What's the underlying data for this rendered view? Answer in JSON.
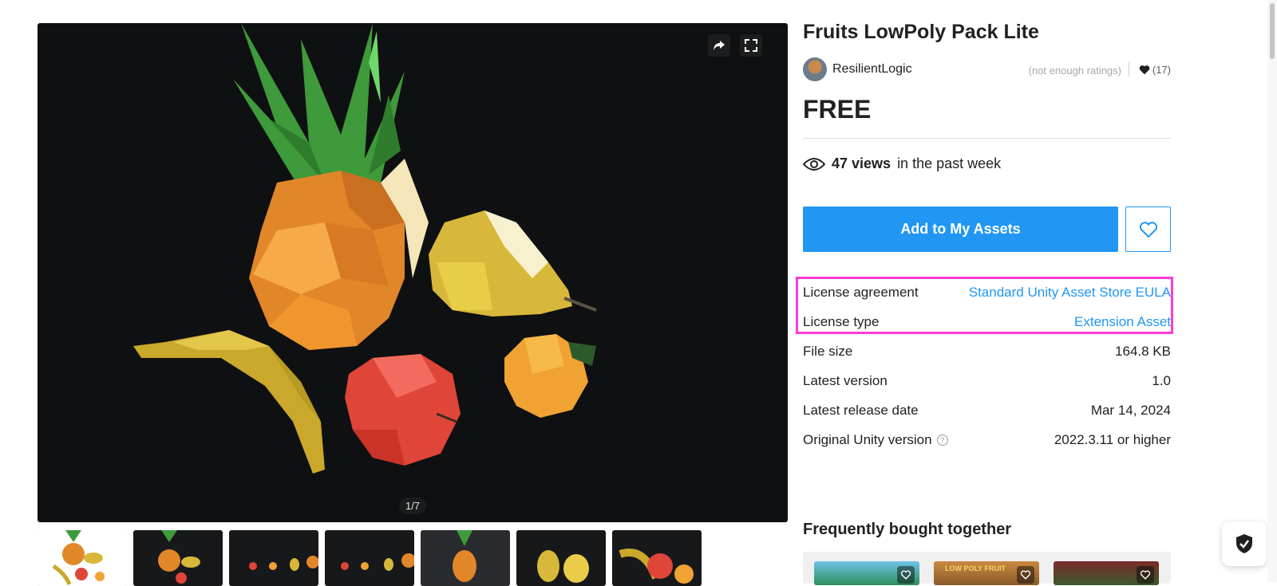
{
  "product": {
    "title": "Fruits LowPoly Pack Lite",
    "publisher": "ResilientLogic",
    "ratings_text": "(not enough ratings)",
    "favorites": "(17)",
    "price": "FREE",
    "views_count": "47 views",
    "views_suffix": "in the past week",
    "add_button": "Add to My Assets"
  },
  "gallery": {
    "counter": "1/7",
    "thumbnail_count": 7,
    "selected_index": 1
  },
  "details": {
    "license_agreement_label": "License agreement",
    "license_agreement_value": "Standard Unity Asset Store EULA",
    "license_type_label": "License type",
    "license_type_value": "Extension Asset",
    "file_size_label": "File size",
    "file_size_value": "164.8 KB",
    "latest_version_label": "Latest version",
    "latest_version_value": "1.0",
    "release_date_label": "Latest release date",
    "release_date_value": "Mar 14, 2024",
    "unity_version_label": "Original Unity version",
    "unity_version_value": "2022.3.11 or higher"
  },
  "related": {
    "title": "Frequently bought together",
    "card_2_text": "LOW POLY FRUIT"
  },
  "colors": {
    "accent": "#2196f3",
    "highlight": "#ff3cd6",
    "viewer_bg": "#0f1011"
  }
}
